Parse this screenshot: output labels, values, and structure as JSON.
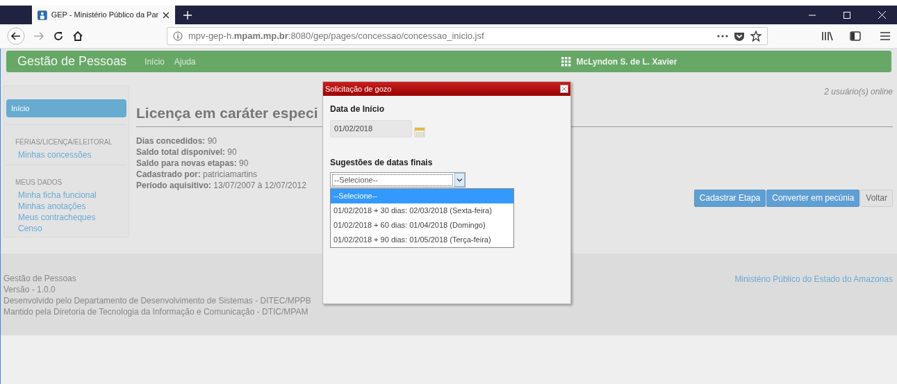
{
  "browser": {
    "tab_title": "GEP - Ministério Público da Par",
    "url": "mpv-gep-h.**mpam.mp.br**:8080/gep/pages/concessao/concessao_inicio.jsf"
  },
  "app": {
    "brand": "Gestão de Pessoas",
    "nav": [
      "Início",
      "Ajuda"
    ],
    "user": "McLyndon S. de L. Xavier"
  },
  "sidebar": [
    {
      "kind": "link",
      "label": "Início",
      "selected": true
    },
    {
      "kind": "heading",
      "label": "FÉRIAS/LICENÇA/ELEITORAL"
    },
    {
      "kind": "link",
      "label": "Minhas concessões",
      "selected": false
    },
    {
      "kind": "heading",
      "label": "MEUS DADOS"
    },
    {
      "kind": "link",
      "label": "Minha ficha funcional",
      "selected": false
    },
    {
      "kind": "link",
      "label": "Minhas anotações",
      "selected": false
    },
    {
      "kind": "link",
      "label": "Meus contracheques",
      "selected": false
    },
    {
      "kind": "link",
      "label": "Censo",
      "selected": false
    }
  ],
  "page": {
    "online": "2 usuário(s) online",
    "title": "Licença em caráter especi",
    "details": [
      "**Dias concedidos:** 90",
      "**Saldo total disponível:** 90",
      "**Saldo para novas etapas:** 90",
      "**Cadastrado por:** patriciamartins",
      "**Período aquisitivo:** 13/07/2007 à 12/07/2012"
    ],
    "buttons": [
      {
        "label": "Cadastrar Etapa",
        "kind": "primary"
      },
      {
        "label": "Converter em pecúnia",
        "kind": "primary"
      },
      {
        "label": "Voltar",
        "kind": "default"
      }
    ]
  },
  "footer": {
    "lines": [
      "Gestão de Pessoas",
      "Versão - 1.0.0",
      "Desenvolvido pelo Departamento de Desenvolvimento de Sistemas - DITEC/MPPB",
      "Mantido pela Diretoria de Tecnologia da Informação e Comunicação - DTIC/MPAM"
    ],
    "link": "Ministério Público do Estado do Amazonas"
  },
  "dialog": {
    "title": "Solicitação de gozo",
    "start_label": "Data de Início",
    "start_value": "01/02/2018",
    "suggestions_label": "Sugestões de datas finais",
    "select_value": "--Selecione--",
    "options": [
      {
        "label": "--Selecione--",
        "selected": true
      },
      {
        "label": "01/02/2018 + 30 dias: 02/03/2018 (Sexta-feira)",
        "selected": false
      },
      {
        "label": "01/02/2018 + 60 dias: 01/04/2018 (Domingo)",
        "selected": false
      },
      {
        "label": "01/02/2018 + 90 dias: 01/05/2018 (Terça-feira)",
        "selected": false
      }
    ]
  }
}
